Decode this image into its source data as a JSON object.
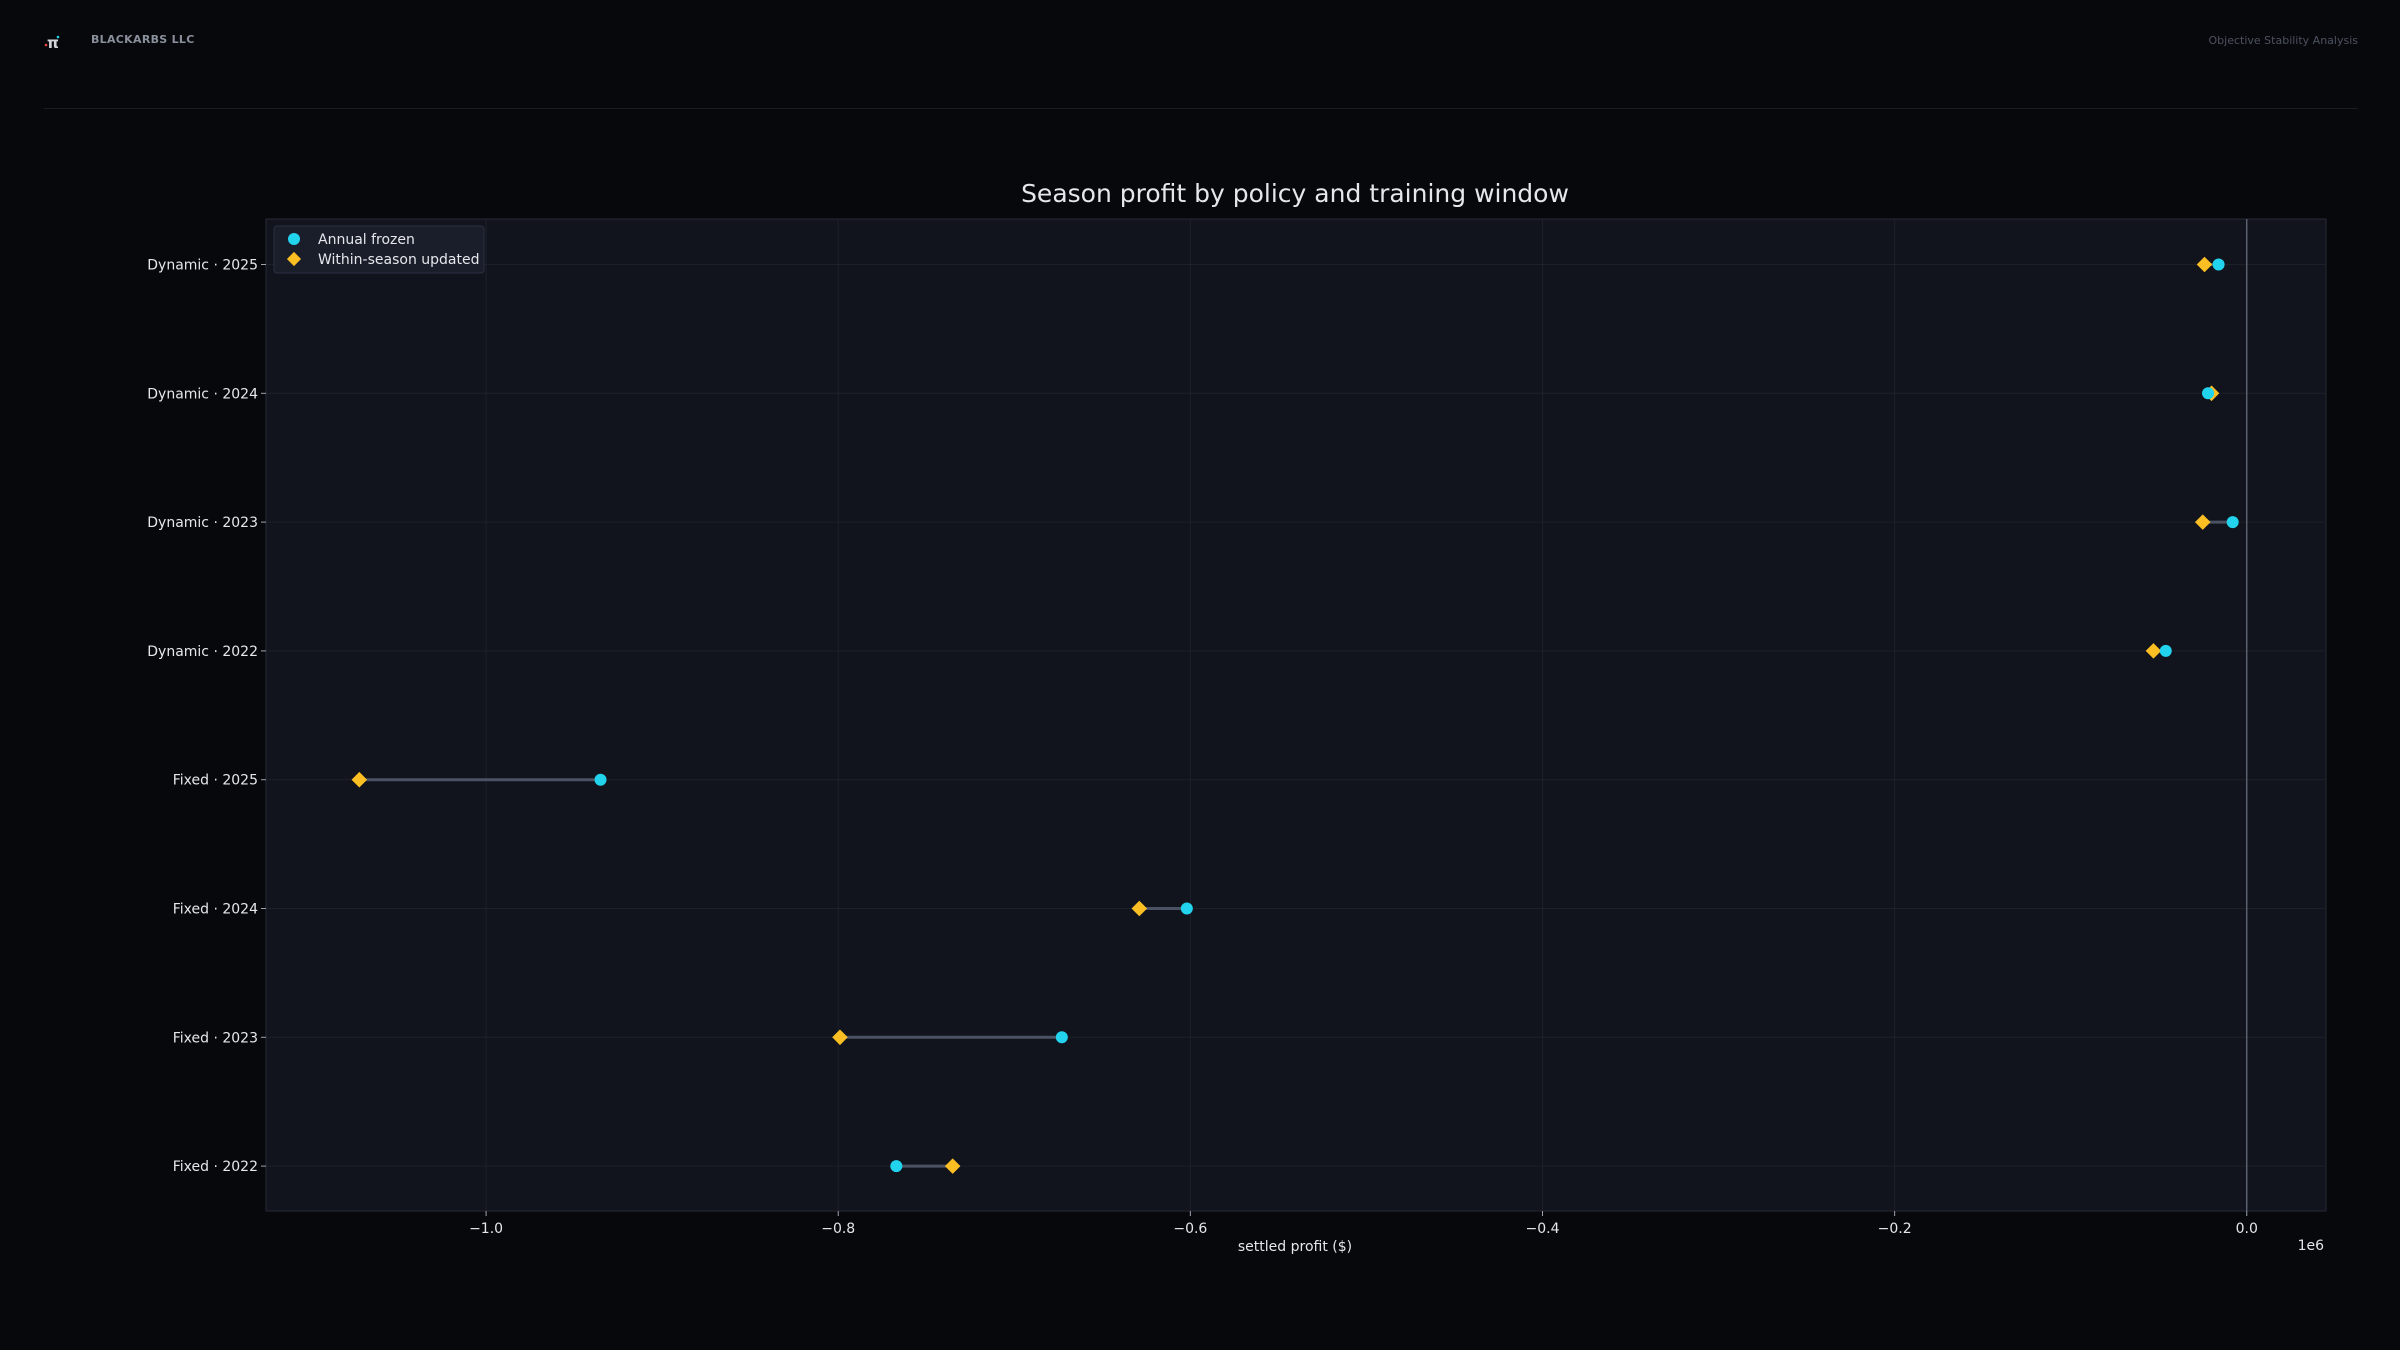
{
  "header": {
    "brand": "BLACKARBS LLC",
    "report_title": "Objective Stability Analysis",
    "logo_glyph": "π"
  },
  "colors": {
    "background": "#07080c",
    "plot_background": "#11131d",
    "annual_frozen": "#22d3ee",
    "within_season_updated": "#fbbf24",
    "connector": "#4b5263",
    "text": "#e5e7eb"
  },
  "chart_data": {
    "type": "scatter",
    "title": "Season profit by policy and training window",
    "xlabel": "settled profit ($)",
    "x_offset_label": "1e6",
    "xlim": [
      -1.125,
      0.045
    ],
    "x_ticks": [
      -1.0,
      -0.8,
      -0.6,
      -0.4,
      -0.2,
      0.0
    ],
    "x_tick_labels": [
      "−1.0",
      "−0.8",
      "−0.6",
      "−0.4",
      "−0.2",
      "0.0"
    ],
    "grid": true,
    "legend_position": "top-left",
    "reference_line_x": 0.0,
    "categories": [
      "Dynamic · 2025",
      "Dynamic · 2024",
      "Dynamic · 2023",
      "Dynamic · 2022",
      "Fixed · 2025",
      "Fixed · 2024",
      "Fixed · 2023",
      "Fixed · 2022"
    ],
    "series": [
      {
        "name": "Annual frozen",
        "marker": "circle",
        "values": [
          -0.016,
          -0.022,
          -0.008,
          -0.046,
          -0.935,
          -0.602,
          -0.673,
          -0.767
        ]
      },
      {
        "name": "Within-season updated",
        "marker": "diamond",
        "values": [
          -0.024,
          -0.02,
          -0.025,
          -0.053,
          -1.072,
          -0.629,
          -0.799,
          -0.735
        ]
      }
    ]
  }
}
